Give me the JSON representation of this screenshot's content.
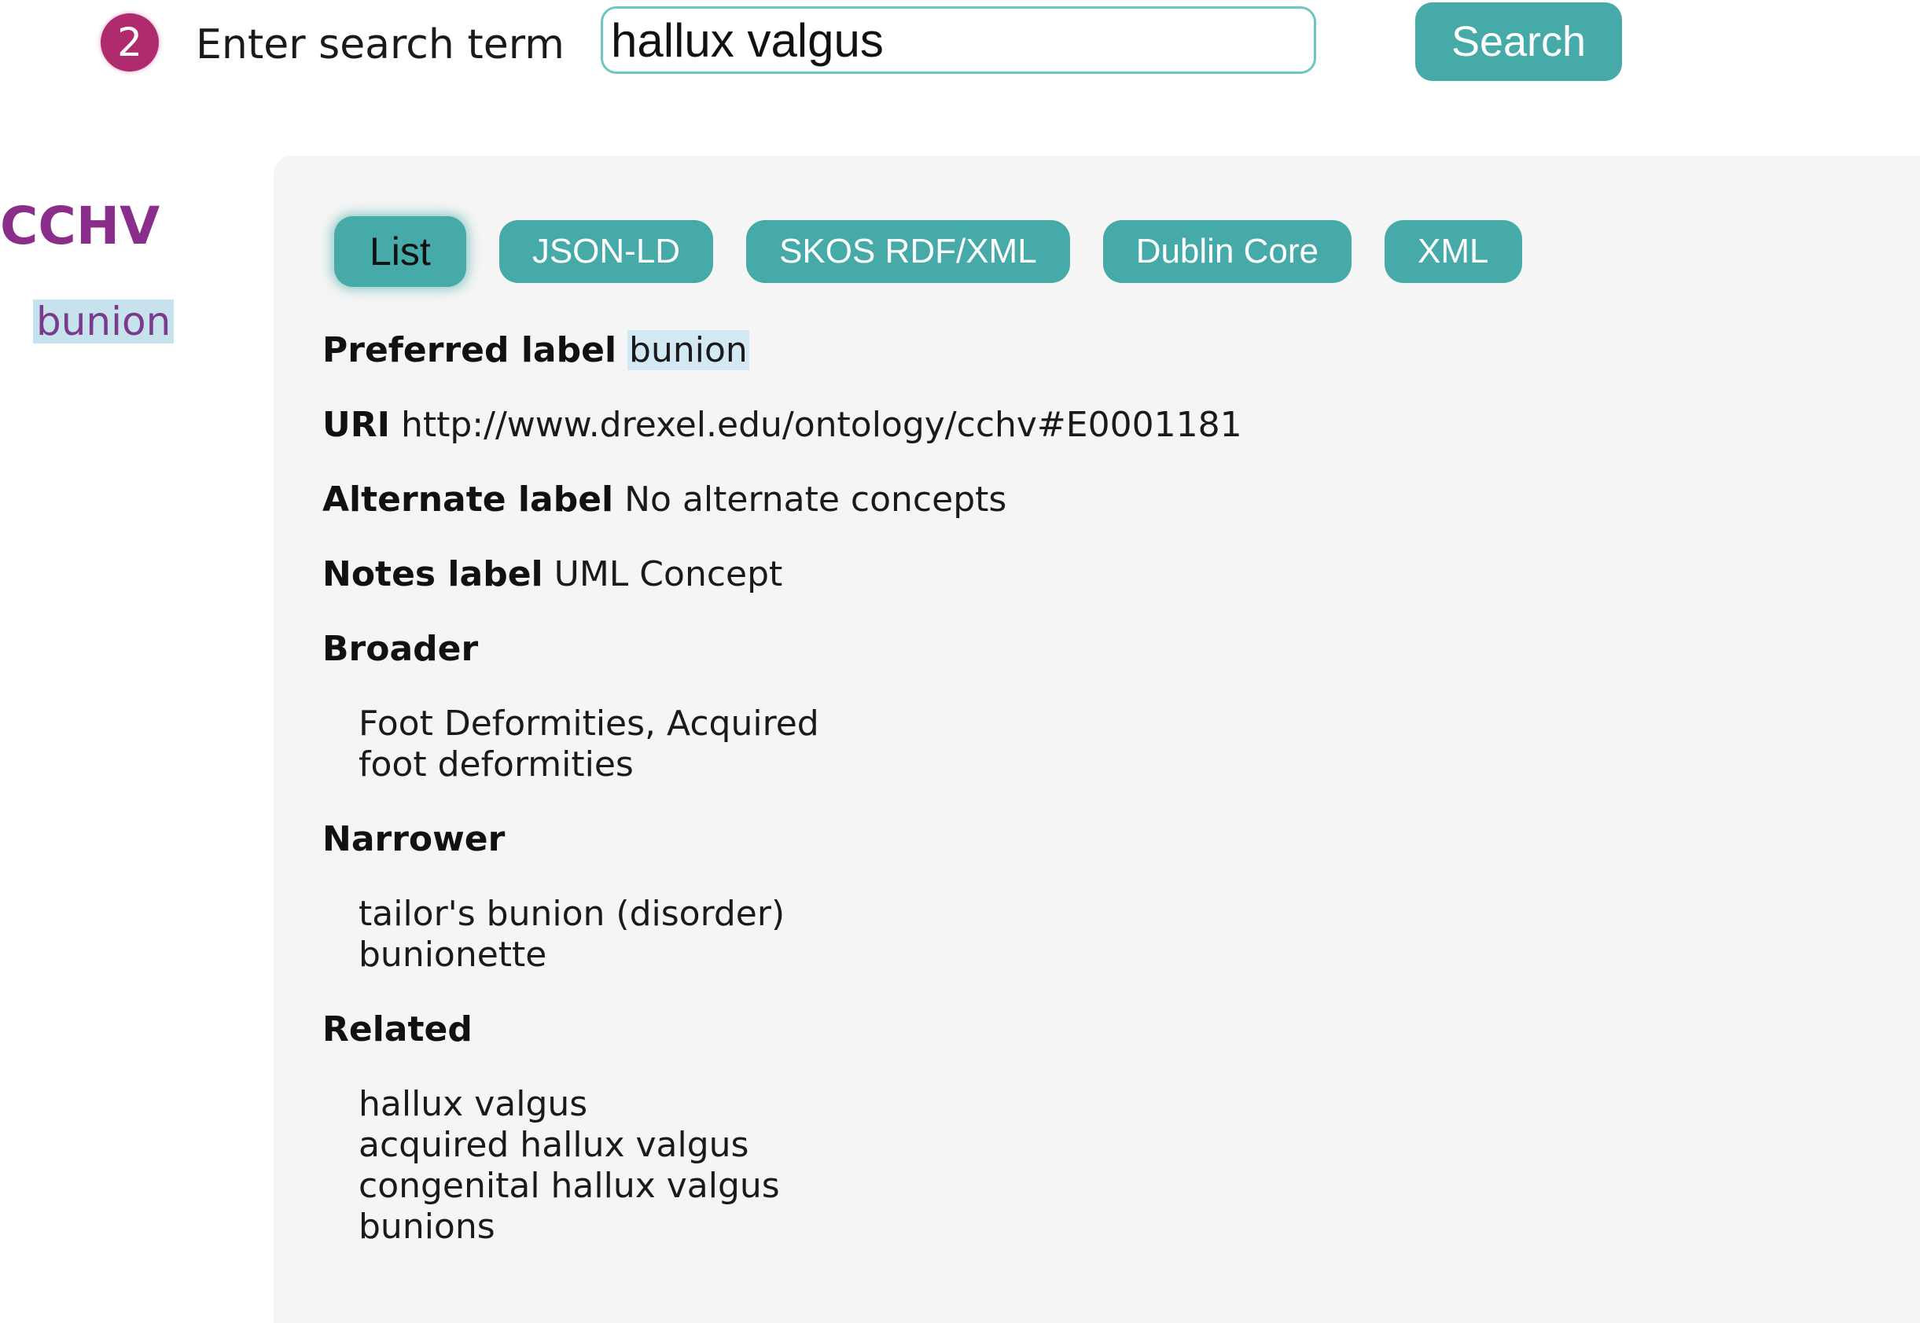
{
  "search": {
    "step_number": "2",
    "label": "Enter search term",
    "value": "hallux valgus",
    "button_label": "Search"
  },
  "sidebar": {
    "vocabulary_title": "CCHV",
    "concept": "bunion"
  },
  "tabs": [
    {
      "label": "List",
      "active": true
    },
    {
      "label": "JSON-LD",
      "active": false
    },
    {
      "label": "SKOS RDF/XML",
      "active": false
    },
    {
      "label": "Dublin Core",
      "active": false
    },
    {
      "label": "XML",
      "active": false
    }
  ],
  "detail": {
    "preferred_label": {
      "label": "Preferred label",
      "value": "bunion"
    },
    "uri": {
      "label": "URI",
      "value": "http://www.drexel.edu/ontology/cchv#E0001181"
    },
    "alternate_label": {
      "label": "Alternate label",
      "value": "No alternate concepts"
    },
    "notes_label": {
      "label": "Notes label",
      "value": "UML Concept"
    },
    "broader": {
      "label": "Broader",
      "items": [
        "Foot Deformities, Acquired",
        "foot deformities"
      ]
    },
    "narrower": {
      "label": "Narrower",
      "items": [
        "tailor's bunion (disorder)",
        "bunionette"
      ]
    },
    "related": {
      "label": "Related",
      "items": [
        "hallux valgus",
        "acquired hallux valgus",
        "congenital hallux valgus",
        "bunions"
      ]
    }
  },
  "colors": {
    "teal": "#45aaa8",
    "badge": "#b02a6e",
    "title_purple": "#8b2d8a",
    "highlight": "#c6e2ec",
    "panel_bg": "#f5f5f5"
  }
}
